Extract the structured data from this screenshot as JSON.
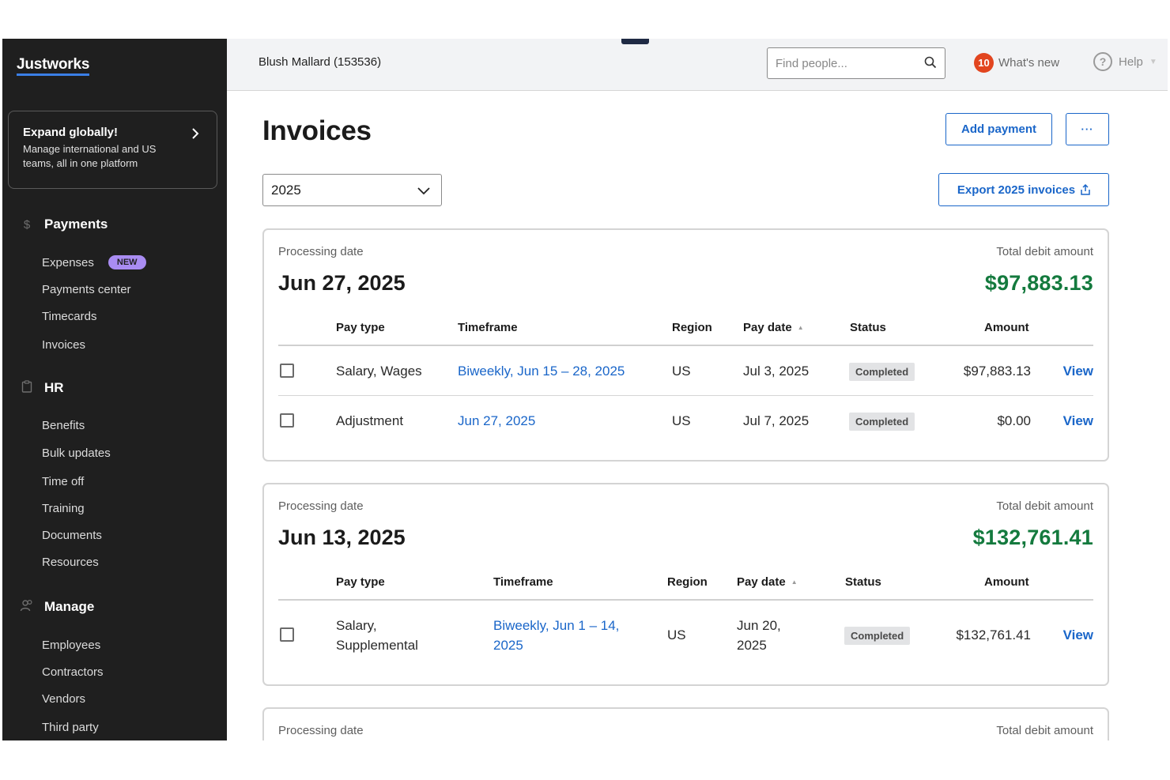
{
  "app": {
    "logo": "Justworks"
  },
  "promo": {
    "title": "Expand globally!",
    "text": "Manage international and US teams, all in one platform"
  },
  "sidebar": {
    "sections": [
      {
        "label": "Payments",
        "icon": "dollar-icon",
        "items": [
          {
            "label": "Expenses",
            "badge": "NEW"
          },
          {
            "label": "Payments center"
          },
          {
            "label": "Timecards"
          },
          {
            "label": "Invoices"
          }
        ]
      },
      {
        "label": "HR",
        "icon": "clipboard-icon",
        "items": [
          {
            "label": "Benefits"
          },
          {
            "label": "Bulk updates"
          },
          {
            "label": "Time off"
          },
          {
            "label": "Training"
          },
          {
            "label": "Documents"
          },
          {
            "label": "Resources"
          }
        ]
      },
      {
        "label": "Manage",
        "icon": "people-icon",
        "items": [
          {
            "label": "Employees"
          },
          {
            "label": "Contractors"
          },
          {
            "label": "Vendors"
          },
          {
            "label": "Third party"
          }
        ]
      }
    ]
  },
  "topbar": {
    "company": "Blush Mallard (153536)",
    "search_placeholder": "Find people...",
    "notifications_count": "10",
    "whats_new": "What's new",
    "help": "Help"
  },
  "main": {
    "title": "Invoices",
    "add_payment": "Add payment",
    "more": "···",
    "year": "2025",
    "export": "Export 2025 invoices"
  },
  "columns": {
    "pay_type": "Pay type",
    "timeframe": "Timeframe",
    "region": "Region",
    "pay_date": "Pay date",
    "status": "Status",
    "amount": "Amount"
  },
  "cards": [
    {
      "processing_label": "Processing date",
      "total_label": "Total debit amount",
      "date": "Jun 27, 2025",
      "total": "$97,883.13",
      "rows": [
        {
          "pay_type": "Salary, Wages",
          "timeframe": "Biweekly,  Jun 15 – 28, 2025",
          "region": "US",
          "pay_date": "Jul 3, 2025",
          "status": "Completed",
          "amount": "$97,883.13",
          "action": "View"
        },
        {
          "pay_type": "Adjustment",
          "timeframe": "Jun 27, 2025",
          "region": "US",
          "pay_date": "Jul 7, 2025",
          "status": "Completed",
          "amount": "$0.00",
          "action": "View"
        }
      ]
    },
    {
      "processing_label": "Processing date",
      "total_label": "Total debit amount",
      "date": "Jun 13, 2025",
      "total": "$132,761.41",
      "rows": [
        {
          "pay_type_line1": "Salary,",
          "pay_type_line2": "Supplemental",
          "timeframe_line1": "Biweekly,  Jun 1 – 14,",
          "timeframe_line2": "2025",
          "region": "US",
          "pay_date_line1": "Jun 20,",
          "pay_date_line2": "2025",
          "status": "Completed",
          "amount": "$132,761.41",
          "action": "View"
        }
      ]
    },
    {
      "processing_label": "Processing date",
      "total_label": "Total debit amount"
    }
  ]
}
